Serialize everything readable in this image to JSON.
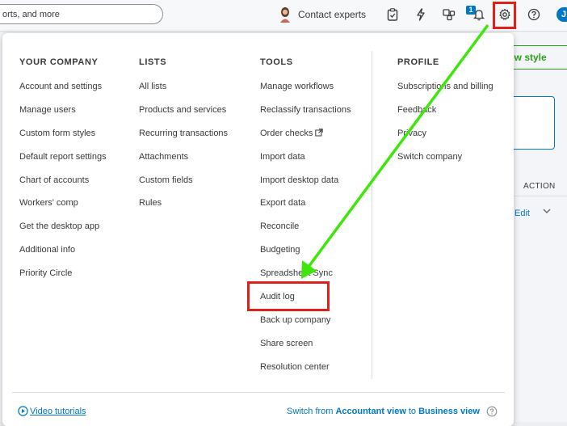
{
  "topbar": {
    "search_text": "orts, and more",
    "contact_label": "Contact experts",
    "notification_count": "1",
    "user_initial": "J"
  },
  "background": {
    "view_style_label": "ew style",
    "action_header": "ACTION",
    "edit_link": "Edit"
  },
  "menu": {
    "company": {
      "heading": "YOUR COMPANY",
      "items": [
        "Account and settings",
        "Manage users",
        "Custom form styles",
        "Default report settings",
        "Chart of accounts",
        "Workers' comp",
        "Get the desktop app",
        "Additional info",
        "Priority Circle"
      ]
    },
    "lists": {
      "heading": "LISTS",
      "items": [
        "All lists",
        "Products and services",
        "Recurring transactions",
        "Attachments",
        "Custom fields",
        "Rules"
      ]
    },
    "tools": {
      "heading": "TOOLS",
      "items": [
        "Manage workflows",
        "Reclassify transactions",
        "Order checks",
        "Import data",
        "Import desktop data",
        "Export data",
        "Reconcile",
        "Budgeting",
        "Spreadsheet Sync",
        "Audit log",
        "Back up company",
        "Share screen",
        "Resolution center"
      ]
    },
    "profile": {
      "heading": "PROFILE",
      "items": [
        "Subscriptions and billing",
        "Feedback",
        "Privacy",
        "Switch company"
      ]
    },
    "footer": {
      "video_tutorials": "Video tutorials",
      "switch_prefix": "Switch from",
      "switch_bold1": "Accountant view",
      "switch_middle": "to",
      "switch_bold2": "Business view"
    }
  },
  "colors": {
    "accent_blue": "#0077c5",
    "highlight_red": "#e0201b",
    "arrow_green": "#3ee60b",
    "brand_green": "#2ca01c"
  },
  "icons": [
    "clipboard-icon",
    "lightning-icon",
    "apps-icon",
    "bell-icon",
    "gear-icon",
    "help-icon",
    "external-link-icon",
    "play-circle-icon"
  ]
}
